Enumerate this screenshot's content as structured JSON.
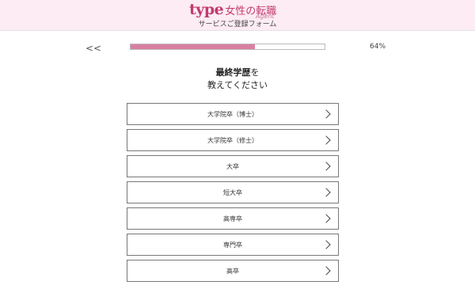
{
  "header": {
    "logo_type": "type",
    "logo_jp": "女性の転職",
    "logo_agent": "Agent",
    "subtitle": "サービスご登録フォーム"
  },
  "nav": {
    "back_label": "<<"
  },
  "progress": {
    "value": 0.64,
    "percent_label": "64%"
  },
  "question": {
    "emphasis": "最終学歴",
    "particle": "を",
    "line2": "教えてください"
  },
  "options": [
    {
      "label": "大学院卒（博士）"
    },
    {
      "label": "大学院卒（修士）"
    },
    {
      "label": "大卒"
    },
    {
      "label": "短大卒"
    },
    {
      "label": "高専卒"
    },
    {
      "label": "専門卒"
    },
    {
      "label": "高卒"
    }
  ],
  "colors": {
    "brand": "#c23a6e",
    "progress_fill": "#d97fa2",
    "header_bg": "#fdecf3"
  },
  "icons": {
    "option_arrow": "chevron-right-icon",
    "back": "double-chevron-left-icon"
  }
}
